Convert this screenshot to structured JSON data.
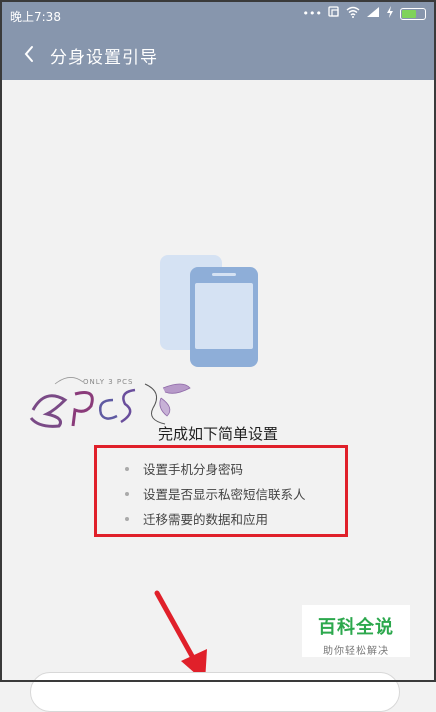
{
  "status_bar": {
    "time": "晚上7:38",
    "battery_color": "#7fd35a"
  },
  "app_bar": {
    "title": "分身设置引导",
    "back_icon": "chevron-left-icon",
    "background": "#8796ad"
  },
  "watermark": {
    "text": "ONLY 3 PCS"
  },
  "content": {
    "heading": "完成如下简单设置",
    "items": [
      "设置手机分身密码",
      "设置是否显示私密短信联系人",
      "迁移需要的数据和应用"
    ],
    "highlight_color": "#e0202a"
  },
  "badge": {
    "name": "百科全说",
    "subtitle": "助你轻松解决",
    "color": "#2ca84d"
  }
}
